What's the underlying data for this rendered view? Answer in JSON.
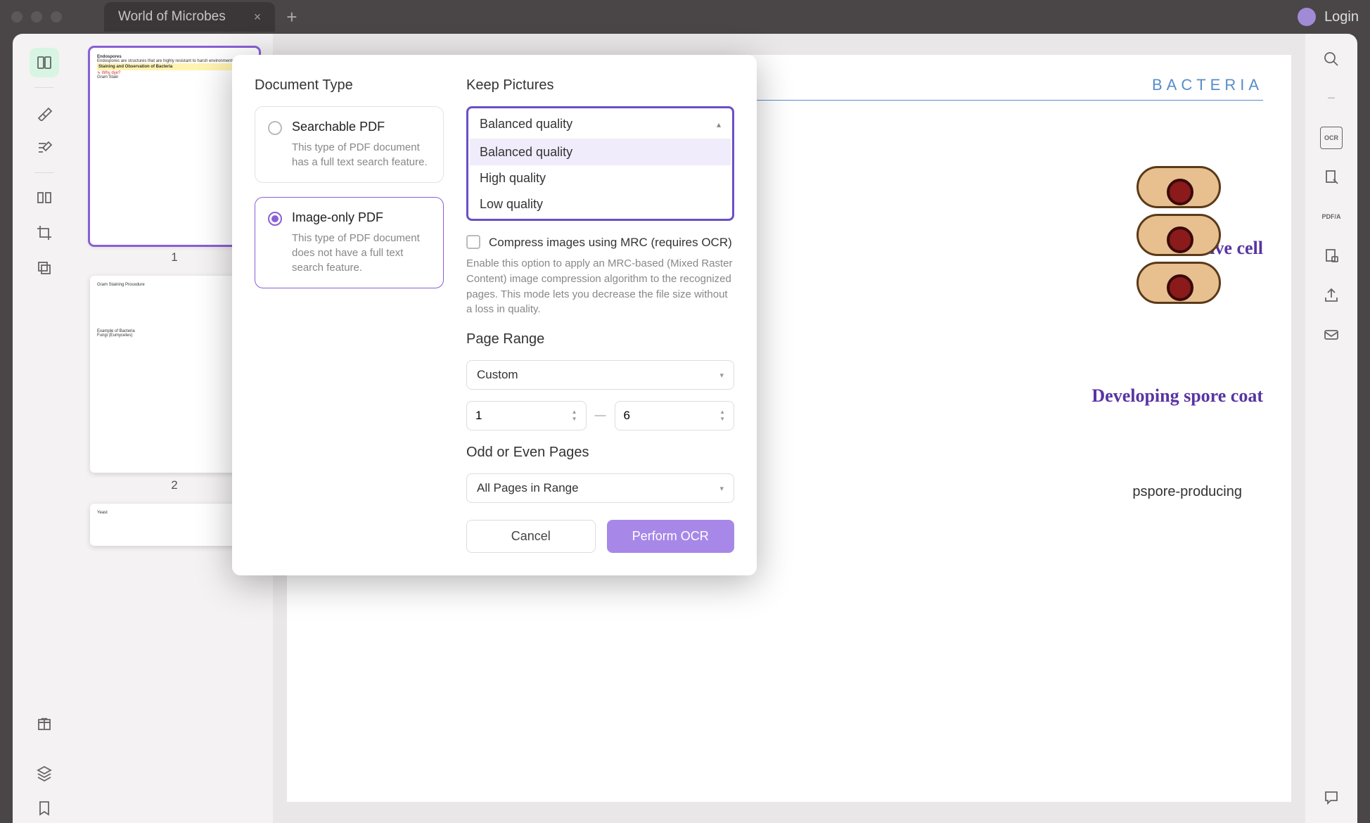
{
  "titlebar": {
    "tab_title": "World of Microbes",
    "login": "Login"
  },
  "thumbnails": [
    {
      "num": "1"
    },
    {
      "num": "2"
    }
  ],
  "page": {
    "heading": "BACTERIA",
    "annot_vegcell": "ative cell",
    "annot_spore": "Developing spore coat",
    "annot_endo": "pspore-producing",
    "staining": "Staining and Observation of Bacteria",
    "whydye": "Why dye?"
  },
  "modal": {
    "doc_type_label": "Document Type",
    "opt1_title": "Searchable PDF",
    "opt1_desc": "This type of PDF document has a full text search feature.",
    "opt2_title": "Image-only PDF",
    "opt2_desc": "This type of PDF document does not have a full text search feature.",
    "keep_pictures_label": "Keep Pictures",
    "quality_selected": "Balanced quality",
    "quality_options": [
      "Balanced quality",
      "High quality",
      "Low quality"
    ],
    "compress_label": "Compress images using MRC (requires OCR)",
    "compress_desc": "Enable this option to apply an MRC-based (Mixed Raster Content) image compression algorithm to the recognized pages. This mode lets you decrease the file size without a loss in quality.",
    "page_range_label": "Page Range",
    "page_range_value": "Custom",
    "range_from": "1",
    "range_to": "6",
    "odd_even_label": "Odd or Even Pages",
    "odd_even_value": "All Pages in Range",
    "cancel": "Cancel",
    "perform": "Perform OCR"
  },
  "right_rail": {
    "ocr": "OCR",
    "pdfa": "PDF/A"
  }
}
